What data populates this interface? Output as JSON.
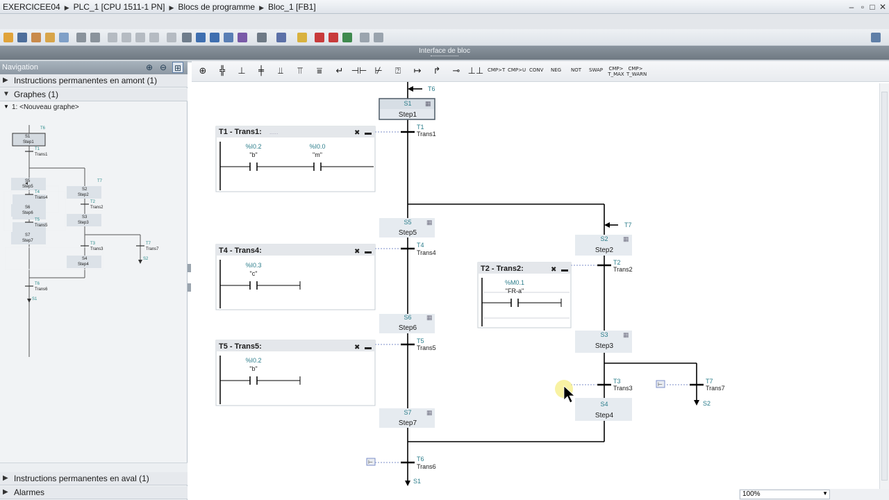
{
  "breadcrumb": [
    "EXERCICEE04",
    "PLC_1 [CPU 1511-1 PN]",
    "Blocs de programme",
    "Bloc_1 [FB1]"
  ],
  "window_controls": [
    "minimize-icon",
    "restore-icon",
    "maximize-icon",
    "close-icon"
  ],
  "interface_strip": "Interface de bloc",
  "navigation": {
    "title": "Navigation",
    "sections": {
      "upstream": "Instructions permanentes en amont (1)",
      "graphs": "Graphes (1)",
      "graph_item": "1: <Nouveau graphe>",
      "downstream": "Instructions permanentes en aval (1)",
      "alarms": "Alarmes"
    }
  },
  "palette_text": [
    "CMP>T",
    "CMP>U",
    "CONV",
    "NEG",
    "NOT",
    "SWAP",
    "CMP> T_MAX",
    "CMP> T_WARN"
  ],
  "zoom": "100%",
  "graph": {
    "steps": [
      {
        "id": "S1",
        "name": "Step1"
      },
      {
        "id": "S5",
        "name": "Step5"
      },
      {
        "id": "S6",
        "name": "Step6"
      },
      {
        "id": "S7",
        "name": "Step7"
      },
      {
        "id": "S2",
        "name": "Step2"
      },
      {
        "id": "S3",
        "name": "Step3"
      },
      {
        "id": "S4",
        "name": "Step4"
      }
    ],
    "transitions": [
      {
        "id": "T1",
        "name": "Trans1"
      },
      {
        "id": "T4",
        "name": "Trans4"
      },
      {
        "id": "T5",
        "name": "Trans5"
      },
      {
        "id": "T6",
        "name": "Trans6"
      },
      {
        "id": "T2",
        "name": "Trans2"
      },
      {
        "id": "T3",
        "name": "Trans3"
      },
      {
        "id": "T7",
        "name": "Trans7"
      }
    ],
    "jumps": {
      "top_in": "T6",
      "s2_in": "T7",
      "end_out": "S1",
      "t7_out": "S2"
    },
    "conditions": [
      {
        "title": "T1 - Trans1:",
        "contacts": [
          {
            "addr": "%I0.2",
            "sym": "\"b\""
          },
          {
            "addr": "%I0.0",
            "sym": "\"m\""
          }
        ]
      },
      {
        "title": "T4 - Trans4:",
        "contacts": [
          {
            "addr": "%I0.3",
            "sym": "\"c\""
          }
        ]
      },
      {
        "title": "T5 - Trans5:",
        "contacts": [
          {
            "addr": "%I0.2",
            "sym": "\"b\""
          }
        ]
      },
      {
        "title": "T2 - Trans2:",
        "contacts": [
          {
            "addr": "%M0.1",
            "sym": "\"FR-a\""
          }
        ]
      }
    ]
  }
}
